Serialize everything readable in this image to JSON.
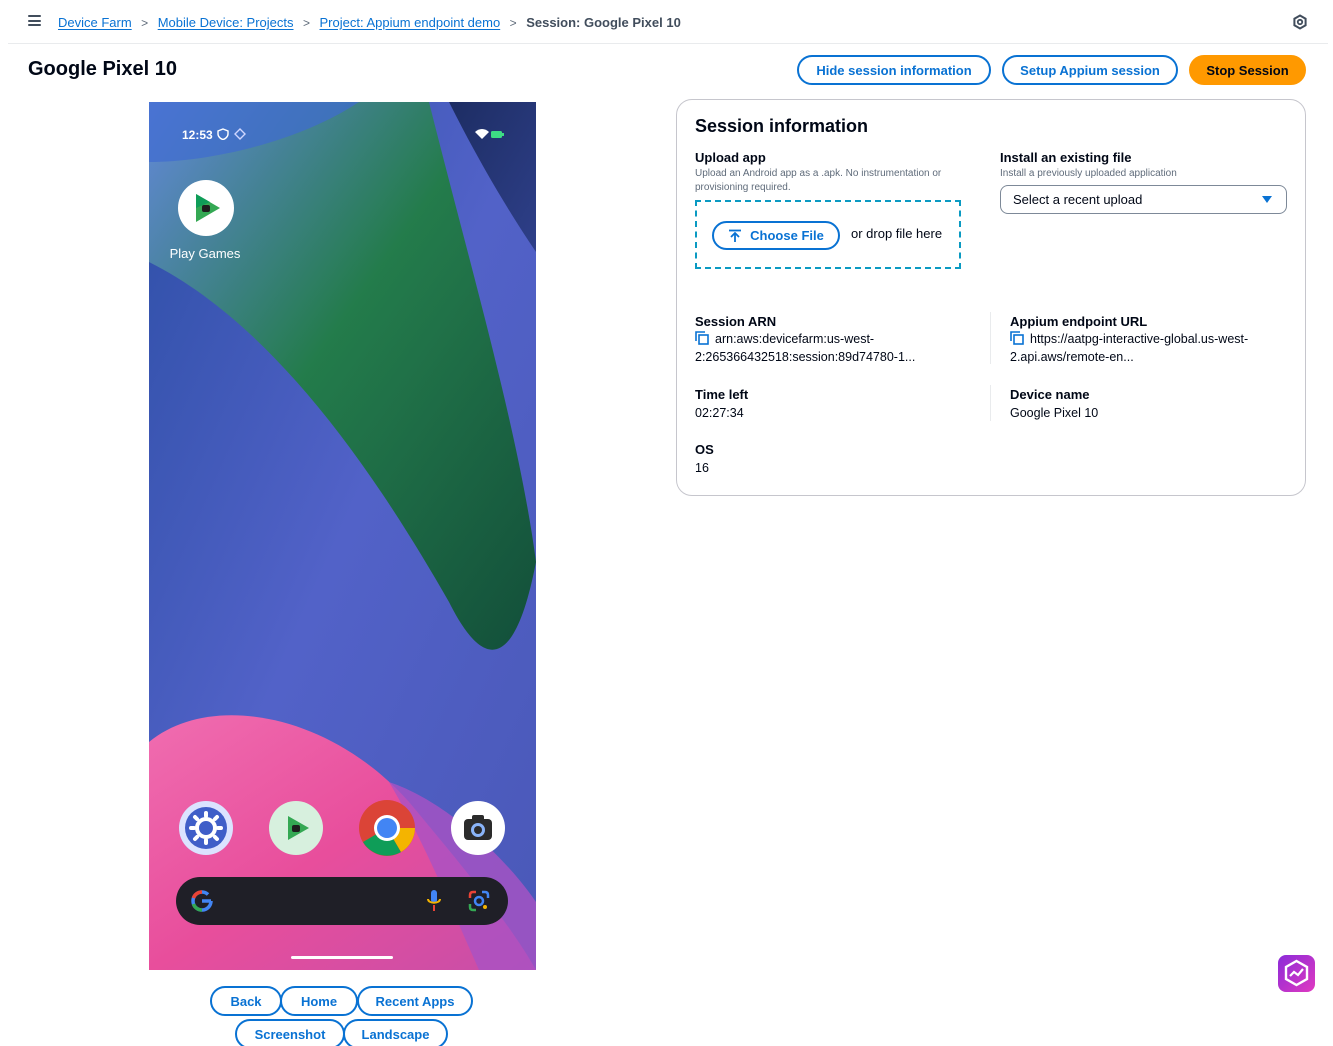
{
  "breadcrumb": {
    "items": [
      "Device Farm",
      "Mobile Device: Projects",
      "Project: Appium endpoint demo"
    ],
    "current": "Session: Google Pixel 10"
  },
  "page": {
    "title": "Google Pixel 10"
  },
  "header_buttons": {
    "hide_info": "Hide session information",
    "setup_appium": "Setup Appium session",
    "stop_session": "Stop Session"
  },
  "device": {
    "status_time": "12:53",
    "home_app_label": "Play Games",
    "dock_apps": [
      "settings-icon",
      "play-games-icon",
      "chrome-icon",
      "camera-icon"
    ],
    "wallpaper_colors": [
      "#4d5fb8",
      "#1e7d3c",
      "#e55fa6"
    ]
  },
  "controls": {
    "back": "Back",
    "home": "Home",
    "recent_apps": "Recent Apps",
    "screenshot": "Screenshot",
    "landscape": "Landscape"
  },
  "session": {
    "title": "Session information",
    "upload": {
      "label": "Upload app",
      "description": "Upload an Android app as a .apk. No instrumentation or provisioning required.",
      "choose_file": "Choose File",
      "drop_text": "or drop file here"
    },
    "install": {
      "label": "Install an existing file",
      "description": "Install a previously uploaded application",
      "select_value": "Select a recent upload"
    },
    "arn": {
      "label": "Session ARN",
      "value_line1": "arn:aws:devicefarm:us-west-",
      "value_line2": "2:265366432518:session:89d74780-1..."
    },
    "endpoint": {
      "label": "Appium endpoint URL",
      "value_line1": "https://aatpg-interactive-global.us-west-",
      "value_line2": "2.api.aws/remote-en..."
    },
    "time_left": {
      "label": "Time left",
      "value": "02:27:34"
    },
    "device_name": {
      "label": "Device name",
      "value": "Google Pixel 10"
    },
    "os": {
      "label": "OS",
      "value": "16"
    }
  },
  "colors": {
    "accent": "#0972d3",
    "primary_button": "#ff9900",
    "dropzone_border": "#0a9ac2"
  }
}
